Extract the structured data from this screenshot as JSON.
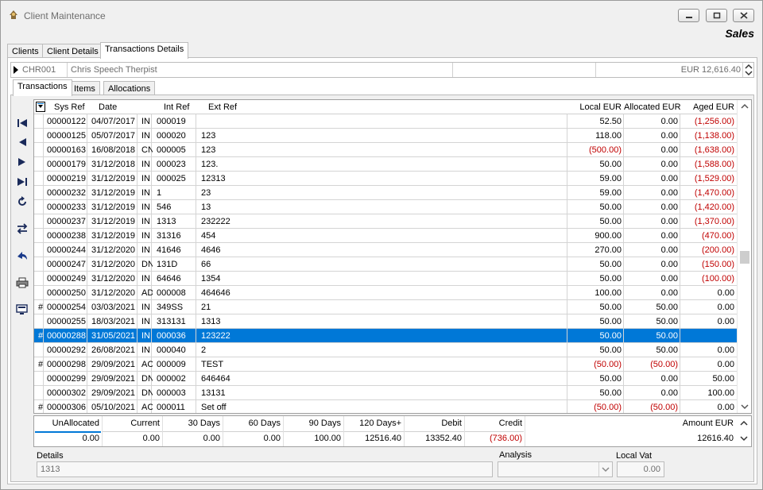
{
  "window": {
    "title": "Client Maintenance",
    "module": "Sales"
  },
  "tabs": [
    "Clients",
    "Client Details",
    "Transactions Details"
  ],
  "client": {
    "code": "CHR001",
    "name": "Chris Speech Therpist",
    "balance": "EUR 12,616.40"
  },
  "subtabs": [
    "Transactions",
    "Items",
    "Allocations"
  ],
  "columns": {
    "sysref": "Sys Ref",
    "date": "Date",
    "intref": "Int Ref",
    "extref": "Ext Ref",
    "local": "Local EUR",
    "allocated": "Allocated EUR",
    "aged": "Aged EUR"
  },
  "rows": [
    {
      "mark": "",
      "sysref": "00000122",
      "date": "04/07/2017",
      "type": "IN",
      "intref": "000019",
      "extref": "",
      "local": "52.50",
      "allocated": "0.00",
      "aged": "(1,256.00)"
    },
    {
      "mark": "",
      "sysref": "00000125",
      "date": "05/07/2017",
      "type": "IN",
      "intref": "000020",
      "extref": "123",
      "local": "118.00",
      "allocated": "0.00",
      "aged": "(1,138.00)"
    },
    {
      "mark": "",
      "sysref": "00000163",
      "date": "16/08/2018",
      "type": "CN",
      "intref": "000005",
      "extref": "123",
      "local": "(500.00)",
      "allocated": "0.00",
      "aged": "(1,638.00)"
    },
    {
      "mark": "",
      "sysref": "00000179",
      "date": "31/12/2018",
      "type": "IN",
      "intref": "000023",
      "extref": "123.",
      "local": "50.00",
      "allocated": "0.00",
      "aged": "(1,588.00)"
    },
    {
      "mark": "",
      "sysref": "00000219",
      "date": "31/12/2019",
      "type": "IN",
      "intref": "000025",
      "extref": "12313",
      "local": "59.00",
      "allocated": "0.00",
      "aged": "(1,529.00)"
    },
    {
      "mark": "",
      "sysref": "00000232",
      "date": "31/12/2019",
      "type": "IN",
      "intref": "1",
      "extref": "23",
      "local": "59.00",
      "allocated": "0.00",
      "aged": "(1,470.00)"
    },
    {
      "mark": "",
      "sysref": "00000233",
      "date": "31/12/2019",
      "type": "IN",
      "intref": "546",
      "extref": "13",
      "local": "50.00",
      "allocated": "0.00",
      "aged": "(1,420.00)"
    },
    {
      "mark": "",
      "sysref": "00000237",
      "date": "31/12/2019",
      "type": "IN",
      "intref": "1313",
      "extref": "232222",
      "local": "50.00",
      "allocated": "0.00",
      "aged": "(1,370.00)"
    },
    {
      "mark": "",
      "sysref": "00000238",
      "date": "31/12/2019",
      "type": "IN",
      "intref": "31316",
      "extref": "454",
      "local": "900.00",
      "allocated": "0.00",
      "aged": "(470.00)"
    },
    {
      "mark": "",
      "sysref": "00000244",
      "date": "31/12/2020",
      "type": "IN",
      "intref": "41646",
      "extref": "4646",
      "local": "270.00",
      "allocated": "0.00",
      "aged": "(200.00)"
    },
    {
      "mark": "",
      "sysref": "00000247",
      "date": "31/12/2020",
      "type": "DN",
      "intref": "131D",
      "extref": "66",
      "local": "50.00",
      "allocated": "0.00",
      "aged": "(150.00)"
    },
    {
      "mark": "",
      "sysref": "00000249",
      "date": "31/12/2020",
      "type": "IN",
      "intref": "64646",
      "extref": "1354",
      "local": "50.00",
      "allocated": "0.00",
      "aged": "(100.00)"
    },
    {
      "mark": "",
      "sysref": "00000250",
      "date": "31/12/2020",
      "type": "AD",
      "intref": "000008",
      "extref": "464646",
      "local": "100.00",
      "allocated": "0.00",
      "aged": "0.00"
    },
    {
      "mark": "#",
      "sysref": "00000254",
      "date": "03/03/2021",
      "type": "IN",
      "intref": "349SS",
      "extref": "21",
      "local": "50.00",
      "allocated": "50.00",
      "aged": "0.00"
    },
    {
      "mark": "",
      "sysref": "00000255",
      "date": "18/03/2021",
      "type": "IN",
      "intref": "313131",
      "extref": "1313",
      "local": "50.00",
      "allocated": "50.00",
      "aged": "0.00"
    },
    {
      "mark": "#",
      "sysref": "00000288",
      "date": "31/05/2021",
      "type": "IN",
      "intref": "000036",
      "extref": "123222",
      "local": "50.00",
      "allocated": "50.00",
      "aged": "",
      "selected": true
    },
    {
      "mark": "",
      "sysref": "00000292",
      "date": "26/08/2021",
      "type": "IN",
      "intref": "000040",
      "extref": "2",
      "local": "50.00",
      "allocated": "50.00",
      "aged": "0.00"
    },
    {
      "mark": "#",
      "sysref": "00000298",
      "date": "29/09/2021",
      "type": "AC",
      "intref": "000009",
      "extref": "TEST",
      "local": "(50.00)",
      "allocated": "(50.00)",
      "aged": "0.00"
    },
    {
      "mark": "",
      "sysref": "00000299",
      "date": "29/09/2021",
      "type": "DN",
      "intref": "000002",
      "extref": "646464",
      "local": "50.00",
      "allocated": "0.00",
      "aged": "50.00"
    },
    {
      "mark": "",
      "sysref": "00000302",
      "date": "29/09/2021",
      "type": "DN",
      "intref": "000003",
      "extref": "13131",
      "local": "50.00",
      "allocated": "0.00",
      "aged": "100.00"
    },
    {
      "mark": "#",
      "sysref": "00000306",
      "date": "05/10/2021",
      "type": "AC",
      "intref": "000011",
      "extref": "Set off",
      "local": "(50.00)",
      "allocated": "(50.00)",
      "aged": "0.00"
    }
  ],
  "summary": {
    "labels": [
      "UnAllocated",
      "Current",
      "30 Days",
      "60 Days",
      "90 Days",
      "120 Days+",
      "Debit",
      "Credit",
      "Amount EUR"
    ],
    "values": [
      "0.00",
      "0.00",
      "0.00",
      "0.00",
      "100.00",
      "12516.40",
      "13352.40",
      "(736.00)",
      "12616.40"
    ]
  },
  "footer": {
    "details_label": "Details",
    "details_value": "1313",
    "analysis_label": "Analysis",
    "analysis_value": "",
    "localvat_label": "Local Vat",
    "localvat_value": "0.00"
  },
  "icons": [
    "app-icon",
    "minimize-icon",
    "maximize-icon",
    "close-icon",
    "first-record-icon",
    "previous-record-icon",
    "next-record-icon",
    "last-record-icon",
    "refresh-icon",
    "swap-icon",
    "undo-icon",
    "print-icon",
    "export-icon"
  ],
  "colors": {
    "selection": "#0078d7",
    "negative": "#c00000"
  }
}
